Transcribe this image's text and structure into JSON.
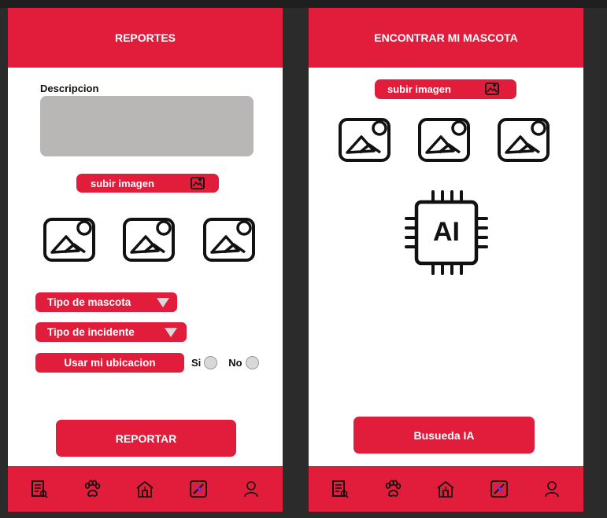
{
  "reportes": {
    "title": "REPORTES",
    "description_label": "Descripcion",
    "upload_label": "subir imagen",
    "pet_type_label": "Tipo de mascota",
    "incident_type_label": "Tipo de incidente",
    "location_label": "Usar mi ubicacion",
    "yes_label": "Si",
    "no_label": "No",
    "submit_label": "REPORTAR"
  },
  "encontrar": {
    "title": "ENCONTRAR MI MASCOTA",
    "upload_label": "subir imagen",
    "ai_label": "AI",
    "search_label": "Busueda IA"
  },
  "nav_icons": [
    "report-icon",
    "paw-icon",
    "shelter-icon",
    "image-search-icon",
    "profile-icon"
  ],
  "colors": {
    "accent": "#e11d3b",
    "background": "#2b2b2b",
    "textarea": "#b9b6b6"
  }
}
